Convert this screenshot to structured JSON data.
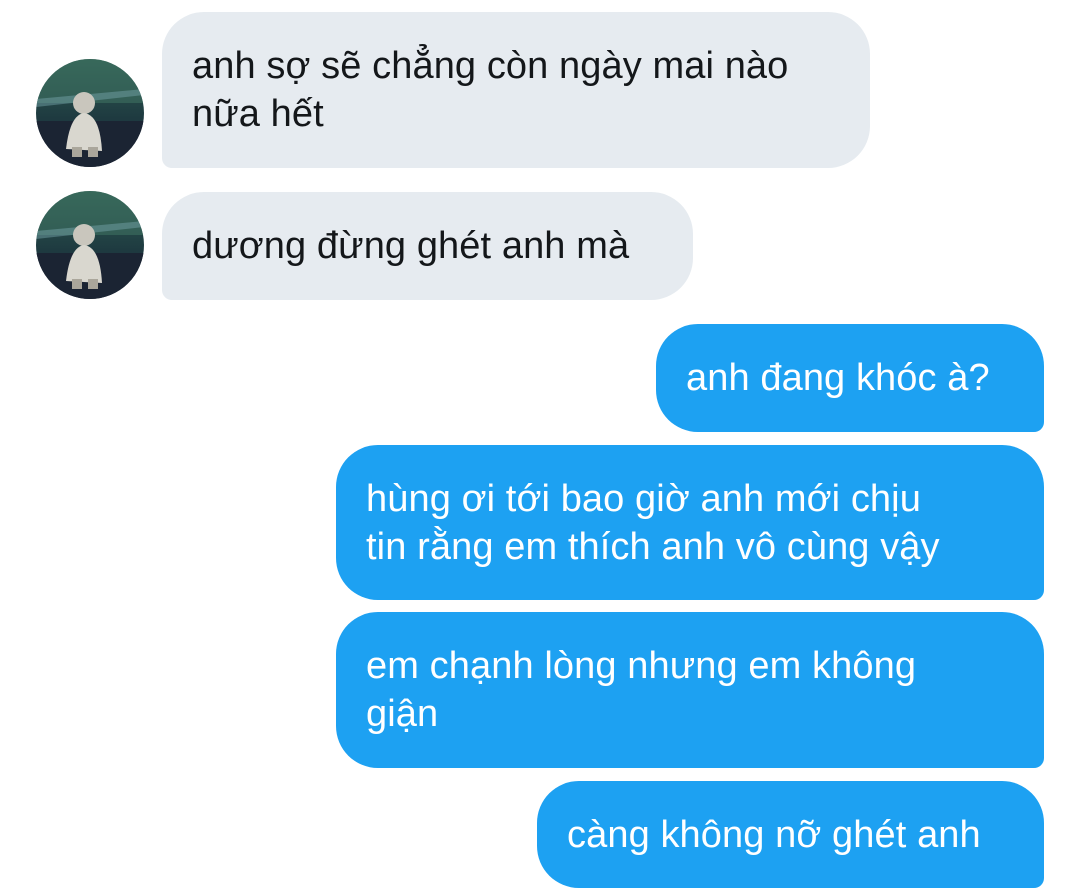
{
  "conversation": {
    "avatar_icon": "contact-photo-icon",
    "colors": {
      "incoming_bg": "#e6ebf0",
      "incoming_text": "#14171a",
      "outgoing_bg": "#1da1f2",
      "outgoing_text": "#ffffff"
    },
    "messages": [
      {
        "direction": "incoming",
        "text_lines": [
          "anh sợ sẽ chẳng còn ngày mai nào",
          "nữa hết"
        ]
      },
      {
        "direction": "incoming",
        "text_lines": [
          "dương đừng ghét anh mà"
        ]
      },
      {
        "direction": "outgoing",
        "text_lines": [
          "anh đang khóc à?"
        ]
      },
      {
        "direction": "outgoing",
        "text_lines": [
          "hùng ơi tới bao giờ anh mới chịu",
          "tin rằng em thích anh vô cùng vậy"
        ]
      },
      {
        "direction": "outgoing",
        "text_lines": [
          "em chạnh lòng nhưng em không",
          "giận"
        ]
      },
      {
        "direction": "outgoing",
        "text_lines": [
          "càng không nỡ ghét anh"
        ]
      }
    ]
  }
}
